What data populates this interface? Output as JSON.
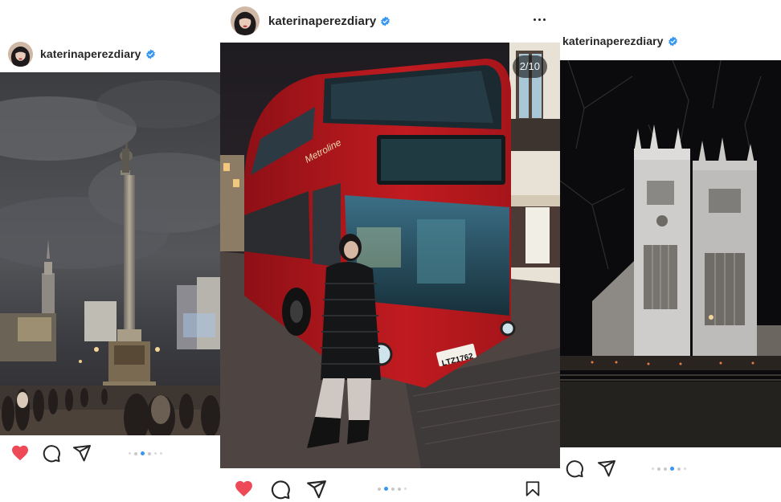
{
  "colors": {
    "verified_blue": "#3797f0",
    "like_red": "#ed4956",
    "dot_active": "#3897f0",
    "dot_inactive": "#c8c8c8"
  },
  "posts": [
    {
      "username": "katerinaperezdiary",
      "verified": true,
      "liked": true,
      "carousel_dots": 6,
      "carousel_active_dot": 3,
      "icons": [
        "heart-icon-filled",
        "comment-icon",
        "share-icon"
      ]
    },
    {
      "username": "katerinaperezdiary",
      "verified": true,
      "photo_counter": "2/10",
      "liked": true,
      "carousel_dots": 5,
      "carousel_active_dot": 2,
      "icons": [
        "more-icon",
        "heart-icon-filled",
        "comment-icon",
        "share-icon",
        "bookmark-icon"
      ],
      "bus": {
        "route_name": "Metroline",
        "plate": "LTZ1762"
      }
    },
    {
      "username": "katerinaperezdiary",
      "verified": true,
      "carousel_dots": 6,
      "carousel_active_dot": 3,
      "icons": [
        "comment-icon",
        "share-icon"
      ]
    }
  ]
}
